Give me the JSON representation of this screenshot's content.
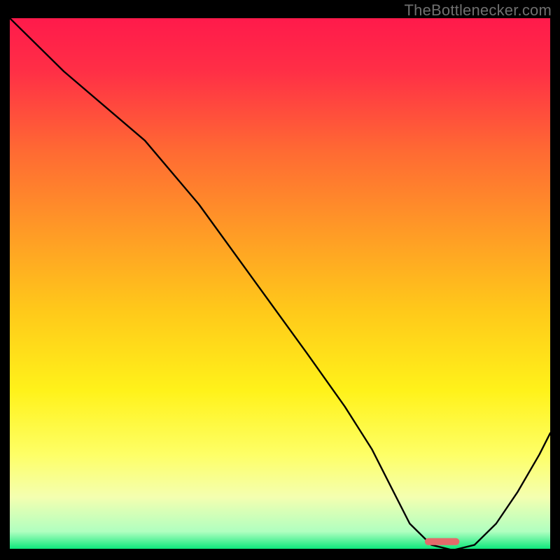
{
  "watermark": "TheBottlenecker.com",
  "chart_data": {
    "type": "line",
    "title": "",
    "xlabel": "",
    "ylabel": "",
    "xlim": [
      0,
      100
    ],
    "ylim": [
      0,
      100
    ],
    "grid": false,
    "legend": false,
    "gradient_stops": [
      {
        "pos": 0.0,
        "color": "#ff1a4b"
      },
      {
        "pos": 0.1,
        "color": "#ff2f46"
      },
      {
        "pos": 0.25,
        "color": "#ff6a33"
      },
      {
        "pos": 0.4,
        "color": "#ff9a26"
      },
      {
        "pos": 0.55,
        "color": "#ffc91a"
      },
      {
        "pos": 0.7,
        "color": "#fff21a"
      },
      {
        "pos": 0.82,
        "color": "#feff66"
      },
      {
        "pos": 0.9,
        "color": "#f4ffb0"
      },
      {
        "pos": 0.965,
        "color": "#b0ffc0"
      },
      {
        "pos": 1.0,
        "color": "#00e676"
      }
    ],
    "series": [
      {
        "name": "bottleneck-curve",
        "color": "#000000",
        "width": 2.4,
        "x": [
          0,
          10,
          25,
          35,
          45,
          55,
          62,
          67,
          71,
          74,
          78,
          82,
          86,
          90,
          94,
          98,
          100
        ],
        "y": [
          100,
          90,
          77,
          65,
          51,
          37,
          27,
          19,
          11,
          5,
          1,
          0,
          1,
          5,
          11,
          18,
          22
        ]
      }
    ],
    "marker": {
      "name": "optimal-range",
      "color": "#e46a6a",
      "x_center": 80,
      "x_halfwidth": 3.2,
      "y": 1.6,
      "thickness": 10,
      "radius": 5
    }
  }
}
